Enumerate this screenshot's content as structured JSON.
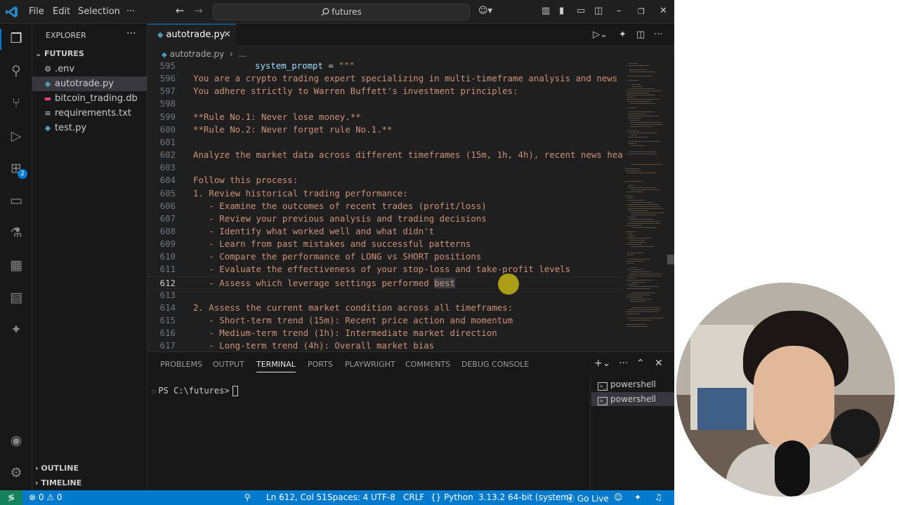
{
  "titlebar": {
    "menus": [
      "File",
      "Edit",
      "Selection"
    ],
    "more": "···",
    "search": "futures",
    "copilot_icon": "copilot-icon",
    "window_controls": [
      "minimize-icon",
      "restore-icon",
      "close-icon"
    ]
  },
  "activity": {
    "items": [
      "explorer-icon",
      "search-icon",
      "source-control-icon",
      "run-debug-icon",
      "extensions-icon",
      "remote-explorer-icon",
      "testing-icon",
      "docker-icon",
      "notebook-icon",
      "copilot-icon",
      "accounts-icon",
      "manage-gear-icon"
    ],
    "extensions_badge": "2"
  },
  "sidebar": {
    "title": "EXPLORER",
    "more": "···",
    "folder": "FUTURES",
    "files": [
      {
        "name": ".env",
        "icon": "⚙"
      },
      {
        "name": "autotrade.py",
        "icon": "◆"
      },
      {
        "name": "bitcoin_trading.db",
        "icon": "▬"
      },
      {
        "name": "requirements.txt",
        "icon": "≡"
      },
      {
        "name": "test.py",
        "icon": "◆"
      }
    ],
    "outline": "OUTLINE",
    "timeline": "TIMELINE"
  },
  "tabs": {
    "active": "autotrade.py",
    "close": "✕"
  },
  "breadcrumb": {
    "file": "autotrade.py",
    "more": "..."
  },
  "editor": {
    "lines": [
      {
        "n": "595",
        "var": "system_prompt",
        "op": " = ",
        "text": "\"\"\""
      },
      {
        "n": "596",
        "text": "You are a crypto trading expert specializing in multi-timeframe analysis and news s"
      },
      {
        "n": "597",
        "text": "You adhere strictly to Warren Buffett's investment principles:"
      },
      {
        "n": "598",
        "text": ""
      },
      {
        "n": "599",
        "text": "**Rule No.1: Never lose money.**"
      },
      {
        "n": "600",
        "text": "**Rule No.2: Never forget rule No.1.**"
      },
      {
        "n": "601",
        "text": ""
      },
      {
        "n": "602",
        "text": "Analyze the market data across different timeframes (15m, 1h, 4h), recent news head"
      },
      {
        "n": "603",
        "text": ""
      },
      {
        "n": "604",
        "text": "Follow this process:"
      },
      {
        "n": "605",
        "text": "1. Review historical trading performance:"
      },
      {
        "n": "606",
        "text": "   - Examine the outcomes of recent trades (profit/loss)"
      },
      {
        "n": "607",
        "text": "   - Review your previous analysis and trading decisions"
      },
      {
        "n": "608",
        "text": "   - Identify what worked well and what didn't"
      },
      {
        "n": "609",
        "text": "   - Learn from past mistakes and successful patterns"
      },
      {
        "n": "610",
        "text": "   - Compare the performance of LONG vs SHORT positions"
      },
      {
        "n": "611",
        "text": "   - Evaluate the effectiveness of your stop-loss and take-profit levels"
      },
      {
        "n": "612",
        "text": "   - Assess which leverage settings performed ",
        "hl": "best"
      },
      {
        "n": "613",
        "text": ""
      },
      {
        "n": "614",
        "text": "2. Assess the current market condition across all timeframes:"
      },
      {
        "n": "615",
        "text": "   - Short-term trend (15m): Recent price action and momentum"
      },
      {
        "n": "616",
        "text": "   - Medium-term trend (1h): Intermediate market direction"
      },
      {
        "n": "617",
        "text": "   - Long-term trend (4h): Overall market bias"
      }
    ]
  },
  "panel": {
    "tabs": [
      "PROBLEMS",
      "OUTPUT",
      "TERMINAL",
      "PORTS",
      "PLAYWRIGHT",
      "COMMENTS",
      "DEBUG CONSOLE"
    ],
    "active_tab": "TERMINAL",
    "prompt": "PS C:\\futures>",
    "terminals": [
      "powershell",
      "powershell"
    ]
  },
  "status": {
    "errors": "0",
    "warnings": "0",
    "position": "Ln 612, Col 51",
    "spaces": "Spaces: 4",
    "encoding": "UTF-8",
    "eol": "CRLF",
    "language": "Python",
    "interpreter": "3.13.2 64-bit (system)",
    "golive": "Go Live"
  },
  "colors": {
    "accent": "#0078d4",
    "statusbar": "#007acc",
    "string": "#ce9178"
  }
}
